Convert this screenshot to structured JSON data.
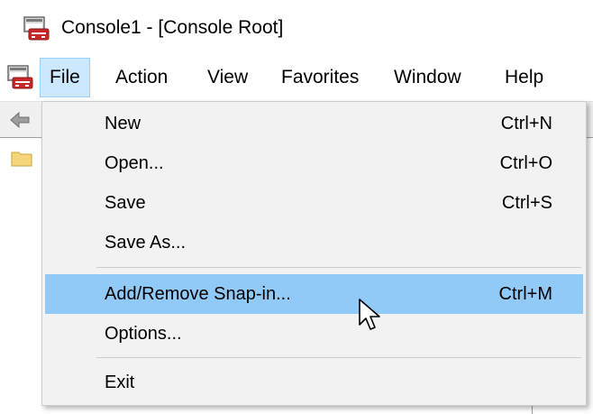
{
  "window": {
    "title": "Console1 - [Console Root]",
    "icon": "mmc-console-icon"
  },
  "menubar": {
    "icon": "mmc-console-icon",
    "items": [
      {
        "label": "File",
        "active": true
      },
      {
        "label": "Action",
        "active": false
      },
      {
        "label": "View",
        "active": false
      },
      {
        "label": "Favorites",
        "active": false
      },
      {
        "label": "Window",
        "active": false
      },
      {
        "label": "Help",
        "active": false
      }
    ]
  },
  "toolbar": {
    "back_icon": "back-arrow-icon"
  },
  "tree": {
    "root_icon": "folder-icon"
  },
  "file_menu": {
    "items": [
      {
        "label": "New",
        "shortcut": "Ctrl+N"
      },
      {
        "label": "Open...",
        "shortcut": "Ctrl+O"
      },
      {
        "label": "Save",
        "shortcut": "Ctrl+S"
      },
      {
        "label": "Save As...",
        "shortcut": ""
      },
      {
        "label": "Add/Remove Snap-in...",
        "shortcut": "Ctrl+M",
        "highlighted": true
      },
      {
        "label": "Options...",
        "shortcut": ""
      },
      {
        "label": "Exit",
        "shortcut": ""
      }
    ]
  },
  "colors": {
    "menu_active_bg": "#cce8ff",
    "menu_active_border": "#99d1ff",
    "dropdown_bg": "#f2f2f2",
    "highlight_bg": "#91c9f7"
  },
  "cursor": "mouse-pointer-icon"
}
